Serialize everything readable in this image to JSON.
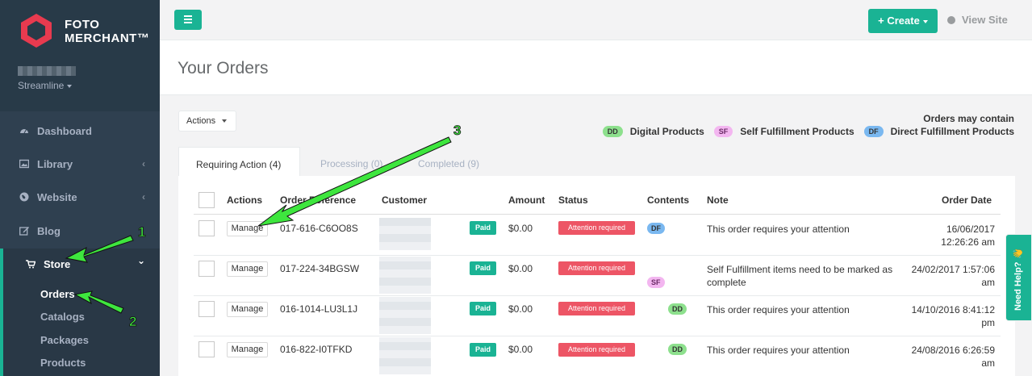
{
  "brand": {
    "line1": "FOTO",
    "line2": "MERCHANT™"
  },
  "user": {
    "role": "Streamline"
  },
  "sidebar": {
    "items": [
      {
        "label": "Dashboard"
      },
      {
        "label": "Library",
        "chevron": "‹"
      },
      {
        "label": "Website",
        "chevron": "‹"
      },
      {
        "label": "Blog"
      },
      {
        "label": "Store",
        "chevron": "⌄"
      }
    ],
    "store_sub": [
      {
        "label": "Orders"
      },
      {
        "label": "Catalogs"
      },
      {
        "label": "Packages"
      },
      {
        "label": "Products"
      }
    ]
  },
  "topbar": {
    "create_label": "+ Create",
    "view_site_label": "View Site"
  },
  "page": {
    "title": "Your Orders"
  },
  "actions_label": "Actions",
  "legend": {
    "title": "Orders may contain",
    "items": [
      {
        "code": "DD",
        "label": "Digital Products"
      },
      {
        "code": "SF",
        "label": "Self Fulfillment Products"
      },
      {
        "code": "DF",
        "label": "Direct Fulfillment Products"
      }
    ]
  },
  "tabs": [
    {
      "label": "Requiring Action (4)"
    },
    {
      "label": "Processing (0)"
    },
    {
      "label": "Completed (9)"
    }
  ],
  "table": {
    "headers": [
      "Actions",
      "Order Reference",
      "Customer",
      "Amount",
      "Status",
      "Contents",
      "Note",
      "Order Date"
    ],
    "manage_label": "Manage",
    "paid_label": "Paid",
    "rows": [
      {
        "ref": "017-616-C6OO8S",
        "amount": "$0.00",
        "status": "Attention required",
        "content": "DF",
        "note": "This order requires your attention",
        "date1": "16/06/2017",
        "date2": "12:26:26 am"
      },
      {
        "ref": "017-224-34BGSW",
        "amount": "$0.00",
        "status": "Attention required",
        "content": "SF",
        "note": "Self Fulfillment items need to be marked as complete",
        "date1": "24/02/2017 1:57:06",
        "date2": "am"
      },
      {
        "ref": "016-1014-LU3L1J",
        "amount": "$0.00",
        "status": "Attention required",
        "content": "DD",
        "note": "This order requires your attention",
        "date1": "14/10/2016 8:41:12",
        "date2": "pm"
      },
      {
        "ref": "016-822-I0TFKD",
        "amount": "$0.00",
        "status": "Attention required",
        "content": "DD",
        "note": "This order requires your attention",
        "date1": "24/08/2016 6:26:59",
        "date2": "am"
      }
    ]
  },
  "help_tab": {
    "label": "Need Help? 👋"
  },
  "annotations": [
    "1",
    "2",
    "3"
  ],
  "colors": {
    "accent": "#1ab394",
    "sidebar": "#2f4050",
    "danger": "#ed5565",
    "arrow": "#39e639"
  }
}
